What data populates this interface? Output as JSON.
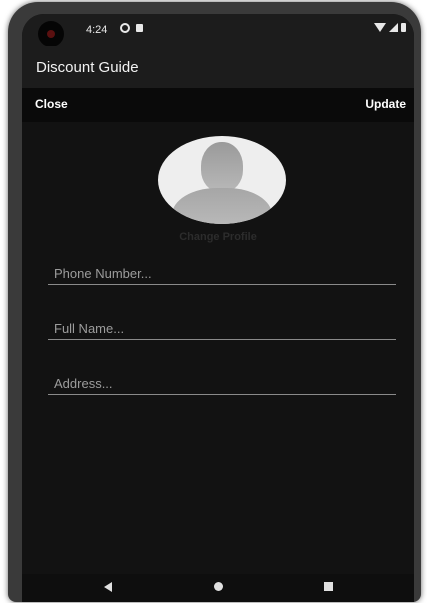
{
  "status_bar": {
    "time": "4:24",
    "icons": [
      "notification-icon",
      "sim-icon",
      "wifi-icon",
      "signal-icon",
      "battery-icon"
    ]
  },
  "app_bar": {
    "title": "Discount Guide"
  },
  "action_bar": {
    "close_label": "Close",
    "update_label": "Update"
  },
  "profile": {
    "avatar_icon": "person-icon",
    "change_label": "Change Profile"
  },
  "form": {
    "phone_placeholder": "Phone Number...",
    "name_placeholder": "Full Name...",
    "address_placeholder": "Address..."
  },
  "nav_bar": {
    "icons": [
      "back-icon",
      "home-icon",
      "recents-icon"
    ]
  },
  "colors": {
    "background": "#121212",
    "app_bar": "#1c1c1c",
    "action_bar": "#0a0a0a",
    "text": "#ffffff",
    "field_underline": "#8a8a8a"
  }
}
